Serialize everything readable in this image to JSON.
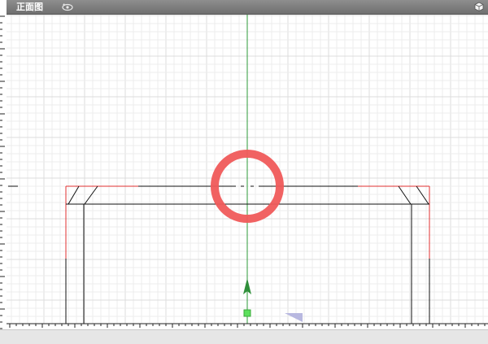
{
  "view": {
    "title": "正面图",
    "title_icon": "camera-rotate-icon",
    "corner_icon": "view-cube-icon"
  },
  "colors": {
    "grid_minor": "#ececec",
    "grid_major": "#dcdcdc",
    "axis_y": "#2e9b3a",
    "outline_black": "#111111",
    "outline_red": "#e03030",
    "marker_ring": "#f05a5a",
    "gizmo_arrow": "#2f8f3a",
    "gizmo_point": "#5ce05c",
    "gizmo_corner": "#b8b8e0"
  }
}
